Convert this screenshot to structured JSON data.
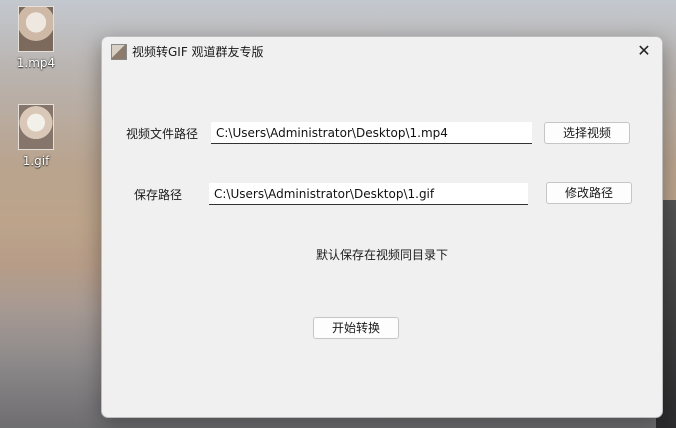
{
  "desktop": {
    "icons": [
      {
        "label": "1.mp4",
        "icon": "video-thumbnail-icon"
      },
      {
        "label": "1.gif",
        "icon": "gif-thumbnail-icon"
      }
    ]
  },
  "window": {
    "title": "视频转GIF 观道群友专版",
    "close_glyph": "✕",
    "video_path_label": "视频文件路径",
    "video_path_value": "C:\\Users\\Administrator\\Desktop\\1.mp4",
    "select_video_label": "选择视频",
    "save_path_label": "保存路径",
    "save_path_value": "C:\\Users\\Administrator\\Desktop\\1.gif",
    "modify_path_label": "修改路径",
    "default_note": "默认保存在视频同目录下",
    "start_label": "开始转换"
  }
}
